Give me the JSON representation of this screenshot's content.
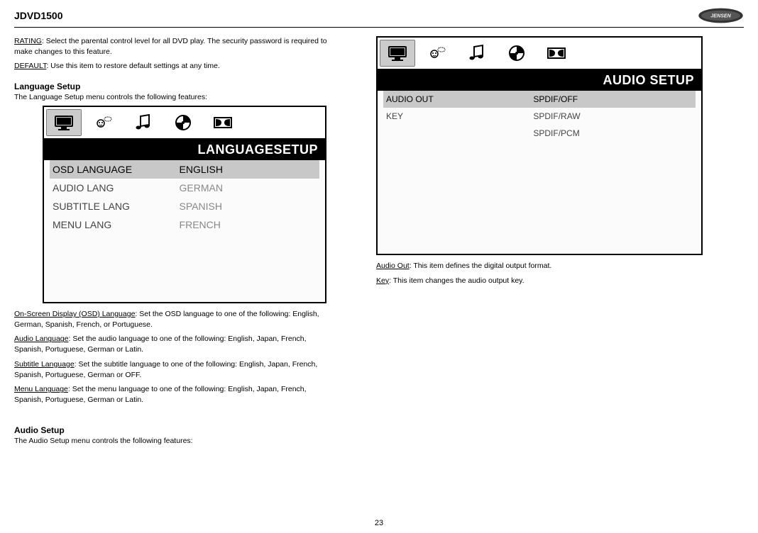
{
  "header": {
    "product_title": "JDVD1500",
    "logo_brand": "JENSEN"
  },
  "left": {
    "rating": {
      "label": "RATING",
      "text": ": Select the parental control level for all DVD play. The security password is required to make changes to this feature."
    },
    "default_": {
      "label": "DEFAULT",
      "text": ": Use this item to restore default settings at any time."
    },
    "lang_setup_heading": "Language Setup",
    "lang_setup_sub": "The Language Setup menu controls the following features:",
    "lang_panel": {
      "title": "LANGUAGESETUP",
      "rows": {
        "osd": {
          "label": "OSD LANGUAGE",
          "value": "ENGLISH"
        },
        "audio": {
          "label": "AUDIO LANG",
          "value": "GERMAN"
        },
        "subtitle": {
          "label": "SUBTITLE LANG",
          "value": "SPANISH"
        },
        "menu": {
          "label": "MENU LANG",
          "value": "FRENCH"
        }
      }
    },
    "osd_lang": {
      "label": "On-Screen Display (OSD) Language",
      "text": ": Set the OSD language to one of the following: English, German, Spanish, French, or Portuguese."
    },
    "audio_lang": {
      "label": "Audio Language",
      "text": ": Set the audio language to one of the following: English, Japan, French, Spanish, Portuguese, German or Latin."
    },
    "subtitle_lang": {
      "label": "Subtitle Language",
      "text": ": Set the subtitle language to one of the following: English, Japan, French, Spanish, Portuguese, German or OFF."
    },
    "menu_lang": {
      "label": "Menu Language",
      "text": ": Set the menu language to one of the following: English, Japan, French, Spanish, Portuguese, German or Latin."
    },
    "audio_setup_heading": "Audio Setup",
    "audio_setup_sub": "The Audio Setup menu controls the following features:"
  },
  "right": {
    "audio_panel": {
      "title": "AUDIO SETUP",
      "rows": {
        "audio_out": {
          "label": "AUDIO OUT",
          "value": "SPDIF/OFF"
        },
        "key": {
          "label": "KEY",
          "value": "SPDIF/RAW"
        },
        "pcm": {
          "label": "",
          "value": "SPDIF/PCM"
        }
      }
    },
    "audio_out": {
      "label": "Audio Out",
      "text": ": This item defines the digital output format."
    },
    "key": {
      "label": "Key",
      "text": ": This item changes the audio output key."
    }
  },
  "page_number": "23"
}
